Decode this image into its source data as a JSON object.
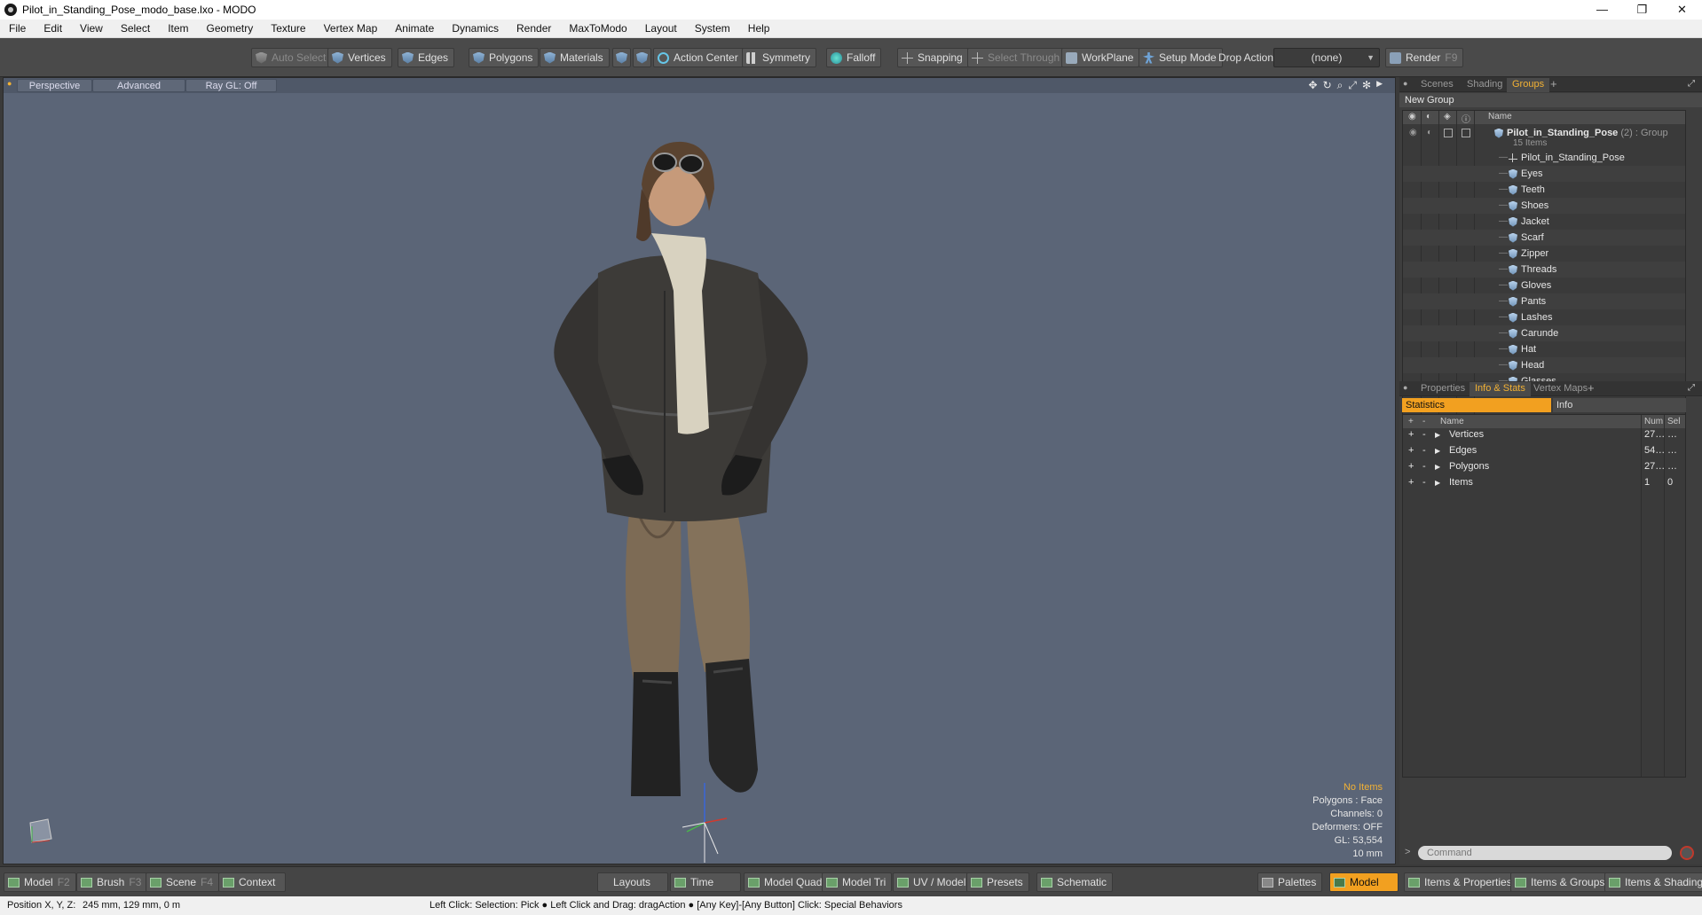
{
  "window": {
    "title": "Pilot_in_Standing_Pose_modo_base.lxo - MODO",
    "controls": [
      "—",
      "❐",
      "✕"
    ]
  },
  "menu": [
    "File",
    "Edit",
    "View",
    "Select",
    "Item",
    "Geometry",
    "Texture",
    "Vertex Map",
    "Animate",
    "Dynamics",
    "Render",
    "MaxToModo",
    "Layout",
    "System",
    "Help"
  ],
  "toolbar": {
    "auto_select": "Auto Select",
    "vertices": "Vertices",
    "edges": "Edges",
    "polygons": "Polygons",
    "materials": "Materials",
    "action_center": "Action Center",
    "symmetry": "Symmetry",
    "falloff": "Falloff",
    "snapping": "Snapping",
    "select_through": "Select Through",
    "workplane": "WorkPlane",
    "setup_mode": "Setup Mode",
    "drop_action_label": "Drop Action",
    "drop_action_value": "(none)",
    "render": "Render",
    "render_key": "F9"
  },
  "viewport": {
    "tabs": [
      "Perspective",
      "Advanced",
      "Ray GL: Off"
    ],
    "stats": {
      "selection": "No Items",
      "polygons": "Polygons : Face",
      "channels": "Channels: 0",
      "deformers": "Deformers: OFF",
      "gl": "GL: 53,554",
      "scale": "10 mm"
    }
  },
  "groups_panel": {
    "tabs": [
      "Scenes",
      "Shading",
      "Groups"
    ],
    "active_tab": "Groups",
    "new_group": "New Group",
    "column_name": "Name",
    "group": {
      "name": "Pilot_in_Standing_Pose",
      "count": "(2)",
      "type": ": Group",
      "items_count": "15 Items"
    },
    "items": [
      "Pilot_in_Standing_Pose",
      "Eyes",
      "Teeth",
      "Shoes",
      "Jacket",
      "Scarf",
      "Zipper",
      "Threads",
      "Gloves",
      "Pants",
      "Lashes",
      "Carunde",
      "Hat",
      "Head",
      "Glasses"
    ]
  },
  "stats_panel": {
    "tabs": [
      "Properties",
      "Info & Stats",
      "Vertex Maps"
    ],
    "active_tab": "Info & Stats",
    "subtabs": [
      "Statistics",
      "Info"
    ],
    "columns": {
      "name": "Name",
      "num": "Num",
      "sel": "Sel"
    },
    "rows": [
      {
        "name": "Vertices",
        "num": "27…",
        "sel": "…"
      },
      {
        "name": "Edges",
        "num": "54…",
        "sel": "…"
      },
      {
        "name": "Polygons",
        "num": "27…",
        "sel": "…"
      },
      {
        "name": "Items",
        "num": "1",
        "sel": "0"
      }
    ],
    "command_placeholder": "Command"
  },
  "bottom": {
    "model": "Model",
    "model_key": "F2",
    "brush": "Brush",
    "brush_key": "F3",
    "scene": "Scene",
    "scene_key": "F4",
    "context": "Context",
    "layouts": "Layouts",
    "time": "Time",
    "model_quad": "Model Quad",
    "model_tri": "Model Tri",
    "uv_model": "UV / Model",
    "presets": "Presets",
    "schematic": "Schematic",
    "palettes": "Palettes",
    "model_active": "Model",
    "items_properties": "Items & Properties",
    "items_groups": "Items & Groups",
    "items_shading": "Items & Shading"
  },
  "status": {
    "position_label": "Position X, Y, Z:",
    "position_value": "245 mm, 129 mm, 0 m",
    "hint": "Left Click: Selection: Pick ● Left Click and Drag: dragAction ● [Any Key]-[Any Button] Click: Special Behaviors"
  }
}
